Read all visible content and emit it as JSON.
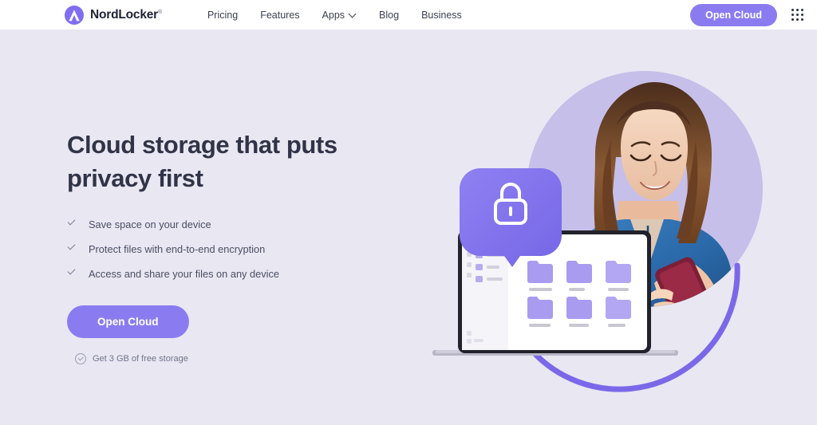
{
  "header": {
    "brand": {
      "name": "NordLocker",
      "trademark": "®",
      "logo_icon": "nordlocker-arch-logo"
    },
    "nav": [
      {
        "label": "Pricing",
        "icon": ""
      },
      {
        "label": "Features",
        "icon": ""
      },
      {
        "label": "Apps",
        "icon": "chevron-down-icon"
      },
      {
        "label": "Blog",
        "icon": ""
      },
      {
        "label": "Business",
        "icon": ""
      }
    ],
    "cta_label": "Open Cloud",
    "apps_grid_icon": "grid-apps-icon"
  },
  "hero": {
    "headline_line1": "Cloud storage that puts",
    "headline_line2": "privacy first",
    "bullets": [
      {
        "icon": "check-icon",
        "label": "Save space on your device"
      },
      {
        "icon": "check-icon",
        "label": "Protect files with end-to-end encryption"
      },
      {
        "icon": "check-icon",
        "label": "Access and share your files on any device"
      }
    ],
    "cta_label": "Open Cloud",
    "free_note": {
      "icon": "circle-check-icon",
      "label": "Get 3 GB of free storage"
    },
    "illustration": {
      "lock_badge_icon": "padlock-icon",
      "laptop_icon": "laptop-device",
      "person_photo": "woman-with-phone-photo",
      "folder_count": 6,
      "sidebar_item_count": 3
    }
  },
  "colors": {
    "brand_purple": "#8a7cf0",
    "hero_background": "#e9e7f2",
    "header_background": "#ffffff",
    "headline_text": "#313447",
    "body_text": "#4b4e63",
    "muted_text": "#71748a",
    "circle_light_purple": "#c6bfe9",
    "arc_purple": "#7b68e8",
    "folder_purple": "#a99bf0",
    "shirt_blue": "#2f6fae",
    "phone_maroon": "#7c1f38"
  }
}
